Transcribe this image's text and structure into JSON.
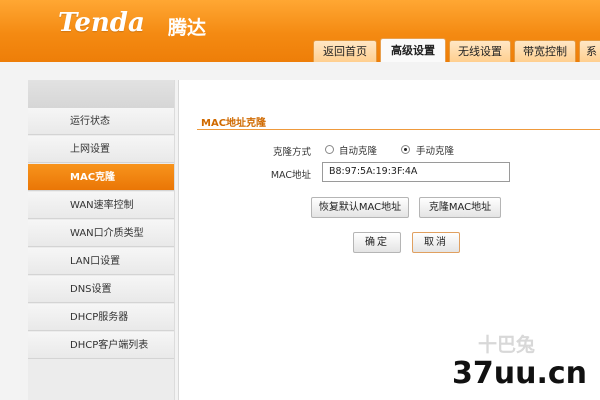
{
  "header": {
    "logo": "Tenda",
    "logo_cn": "腾达",
    "tabs": [
      {
        "label": "返回首页",
        "active": false
      },
      {
        "label": "高级设置",
        "active": true
      },
      {
        "label": "无线设置",
        "active": false
      },
      {
        "label": "带宽控制",
        "active": false
      },
      {
        "label": "系",
        "active": false
      }
    ]
  },
  "sidebar": {
    "items": [
      {
        "label": "运行状态",
        "active": false
      },
      {
        "label": "上网设置",
        "active": false
      },
      {
        "label": "MAC克隆",
        "active": true
      },
      {
        "label": "WAN速率控制",
        "active": false
      },
      {
        "label": "WAN口介质类型",
        "active": false
      },
      {
        "label": "LAN口设置",
        "active": false
      },
      {
        "label": "DNS设置",
        "active": false
      },
      {
        "label": "DHCP服务器",
        "active": false
      },
      {
        "label": "DHCP客户端列表",
        "active": false
      }
    ]
  },
  "main": {
    "section_title": "MAC地址克隆",
    "clone_mode": {
      "label": "克隆方式",
      "options": [
        {
          "label": "自动克隆",
          "selected": false
        },
        {
          "label": "手动克隆",
          "selected": true
        }
      ]
    },
    "mac_address": {
      "label": "MAC地址",
      "value": "B8:97:5A:19:3F:4A"
    },
    "buttons": {
      "restore_default": "恢复默认MAC地址",
      "clone_mac": "克隆MAC地址",
      "ok": "确定",
      "cancel": "取消"
    }
  },
  "watermark": {
    "faint": "十巴兔",
    "main": "37uu.cn"
  },
  "colors": {
    "header_orange": "#f48a12",
    "active_orange": "#ea7606",
    "title_orange": "#d06a00"
  }
}
